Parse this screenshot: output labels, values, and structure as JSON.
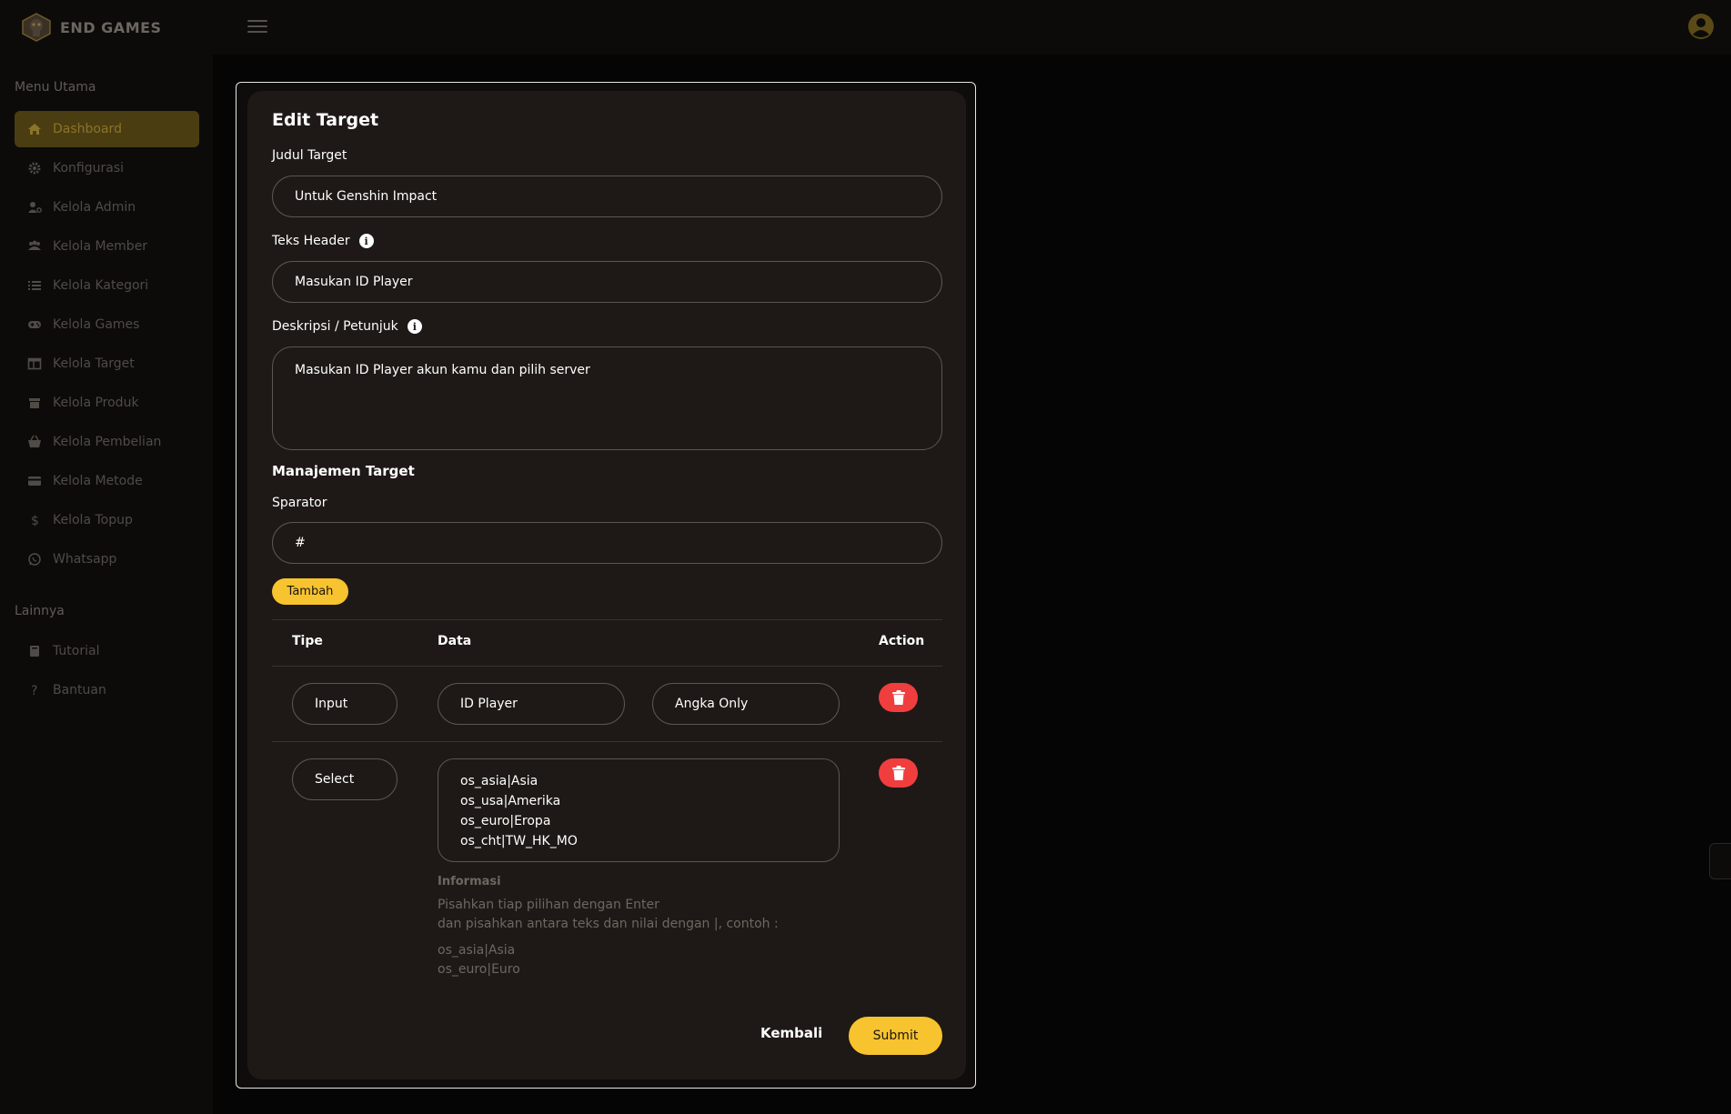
{
  "app": {
    "brand": "END GAMES"
  },
  "sidebar": {
    "section_main": "Menu Utama",
    "items": [
      {
        "label": "Dashboard",
        "icon": "home-icon",
        "active": true
      },
      {
        "label": "Konfigurasi",
        "icon": "gear-icon"
      },
      {
        "label": "Kelola Admin",
        "icon": "user-gear-icon"
      },
      {
        "label": "Kelola Member",
        "icon": "users-icon"
      },
      {
        "label": "Kelola Kategori",
        "icon": "list-icon"
      },
      {
        "label": "Kelola Games",
        "icon": "gamepad-icon"
      },
      {
        "label": "Kelola Target",
        "icon": "table-icon"
      },
      {
        "label": "Kelola Produk",
        "icon": "box-icon"
      },
      {
        "label": "Kelola Pembelian",
        "icon": "basket-icon"
      },
      {
        "label": "Kelola Metode",
        "icon": "credit-card-icon"
      },
      {
        "label": "Kelola Topup",
        "icon": "dollar-icon"
      },
      {
        "label": "Whatsapp",
        "icon": "whatsapp-icon"
      }
    ],
    "section_other": "Lainnya",
    "other_items": [
      {
        "label": "Tutorial",
        "icon": "book-icon"
      },
      {
        "label": "Bantuan",
        "icon": "question-icon"
      }
    ]
  },
  "form": {
    "title": "Edit Target",
    "judul_label": "Judul Target",
    "judul_value": "Untuk Genshin Impact",
    "header_label": "Teks Header",
    "header_value": "Masukan ID Player",
    "desc_label": "Deskripsi / Petunjuk",
    "desc_value": "Masukan ID Player akun kamu dan pilih server",
    "manajemen_label": "Manajemen Target",
    "separator_label": "Sparator",
    "separator_value": "#",
    "add_button": "Tambah",
    "table": {
      "headers": {
        "tipe": "Tipe",
        "data": "Data",
        "action": "Action"
      },
      "rows": [
        {
          "tipe": "Input",
          "data_name": "ID Player",
          "data_rule": "Angka Only"
        },
        {
          "tipe": "Select",
          "options": [
            "os_asia|Asia",
            "os_usa|Amerika",
            "os_euro|Eropa",
            "os_cht|TW_HK_MO"
          ]
        }
      ]
    },
    "info": {
      "title": "Informasi",
      "line1": "Pisahkan tiap pilihan dengan Enter",
      "line2": "dan pisahkan antara teks dan nilai dengan |, contoh :",
      "example1": "os_asia|Asia",
      "example2": "os_euro|Euro"
    },
    "back_button": "Kembali",
    "submit_button": "Submit"
  },
  "colors": {
    "accent": "#f7c32e",
    "danger": "#f03e3e",
    "card": "#1e1916"
  }
}
